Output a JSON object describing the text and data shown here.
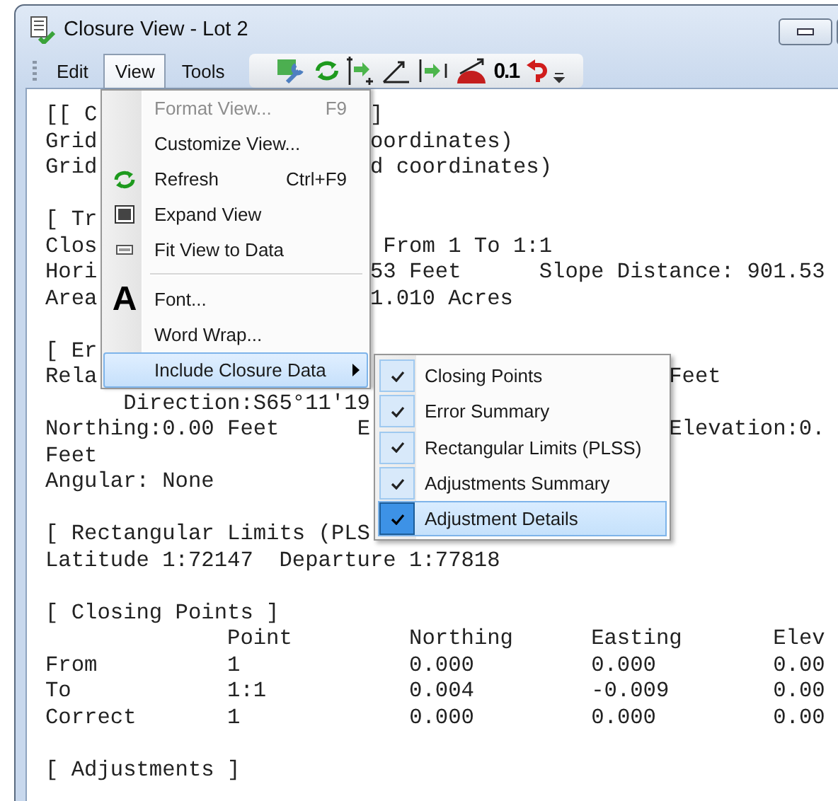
{
  "window": {
    "title": "Closure View - Lot 2"
  },
  "menubar": {
    "items": [
      {
        "label": "Edit",
        "selected": false
      },
      {
        "label": "View",
        "selected": true
      },
      {
        "label": "Tools",
        "selected": false
      }
    ]
  },
  "toolbar": {
    "precision": "0.1"
  },
  "report": [
    [
      "[[ C                     ]",
      "Grid                     oordinates)",
      "Grid                     d coordinates)"
    ],
    [
      "[ Tr",
      "Clos                      From 1 To 1:1",
      "Hori                     53 Feet      Slope Distance: 901.53",
      "Area                     1.010 Acres"
    ],
    [
      "[ Er",
      "Rela                                            Feet",
      "      Direction:S65°11'19",
      "Northing:0.00 Feet      E                       Elevation:0.",
      "Feet",
      "Angular: None"
    ],
    [
      "[ Rectangular Limits (PLS",
      "Latitude 1:72147  Departure 1:77818"
    ],
    [
      "[ Closing Points ]",
      "              Point         Northing      Easting       Elev",
      "From          1             0.000         0.000         0.00",
      "To            1:1           0.004         -0.009        0.00",
      "Correct       1             0.000         0.000         0.00"
    ],
    [
      "[ Adjustments ]"
    ]
  ],
  "menu": {
    "items": [
      {
        "kind": "command",
        "label": "Format View...",
        "shortcut": "F9",
        "disabled": true,
        "selected": false,
        "has_submenu": false
      },
      {
        "kind": "command",
        "label": "Customize View...",
        "disabled": false,
        "selected": false,
        "has_submenu": false
      },
      {
        "kind": "command",
        "label": "Refresh",
        "shortcut": "Ctrl+F9",
        "disabled": false,
        "selected": false,
        "has_submenu": false
      },
      {
        "kind": "command",
        "label": "Expand View",
        "disabled": false,
        "selected": false,
        "has_submenu": false
      },
      {
        "kind": "command",
        "label": "Fit View to Data",
        "disabled": false,
        "selected": false,
        "has_submenu": false
      },
      {
        "kind": "separator"
      },
      {
        "kind": "command",
        "label": "Font...",
        "icon_text": "A",
        "disabled": false,
        "selected": false,
        "has_submenu": false
      },
      {
        "kind": "command",
        "label": "Word Wrap...",
        "disabled": false,
        "selected": false,
        "has_submenu": false
      },
      {
        "kind": "command",
        "label": "Include Closure Data",
        "disabled": false,
        "selected": true,
        "has_submenu": true
      }
    ]
  },
  "submenu": {
    "items": [
      {
        "label": "Closing Points",
        "checked": true,
        "selected": false
      },
      {
        "label": "Error Summary",
        "checked": true,
        "selected": false
      },
      {
        "label": "Rectangular Limits (PLSS)",
        "checked": true,
        "selected": false
      },
      {
        "label": "Adjustments Summary",
        "checked": true,
        "selected": false
      },
      {
        "label": "Adjustment Details",
        "checked": true,
        "selected": true
      }
    ]
  }
}
